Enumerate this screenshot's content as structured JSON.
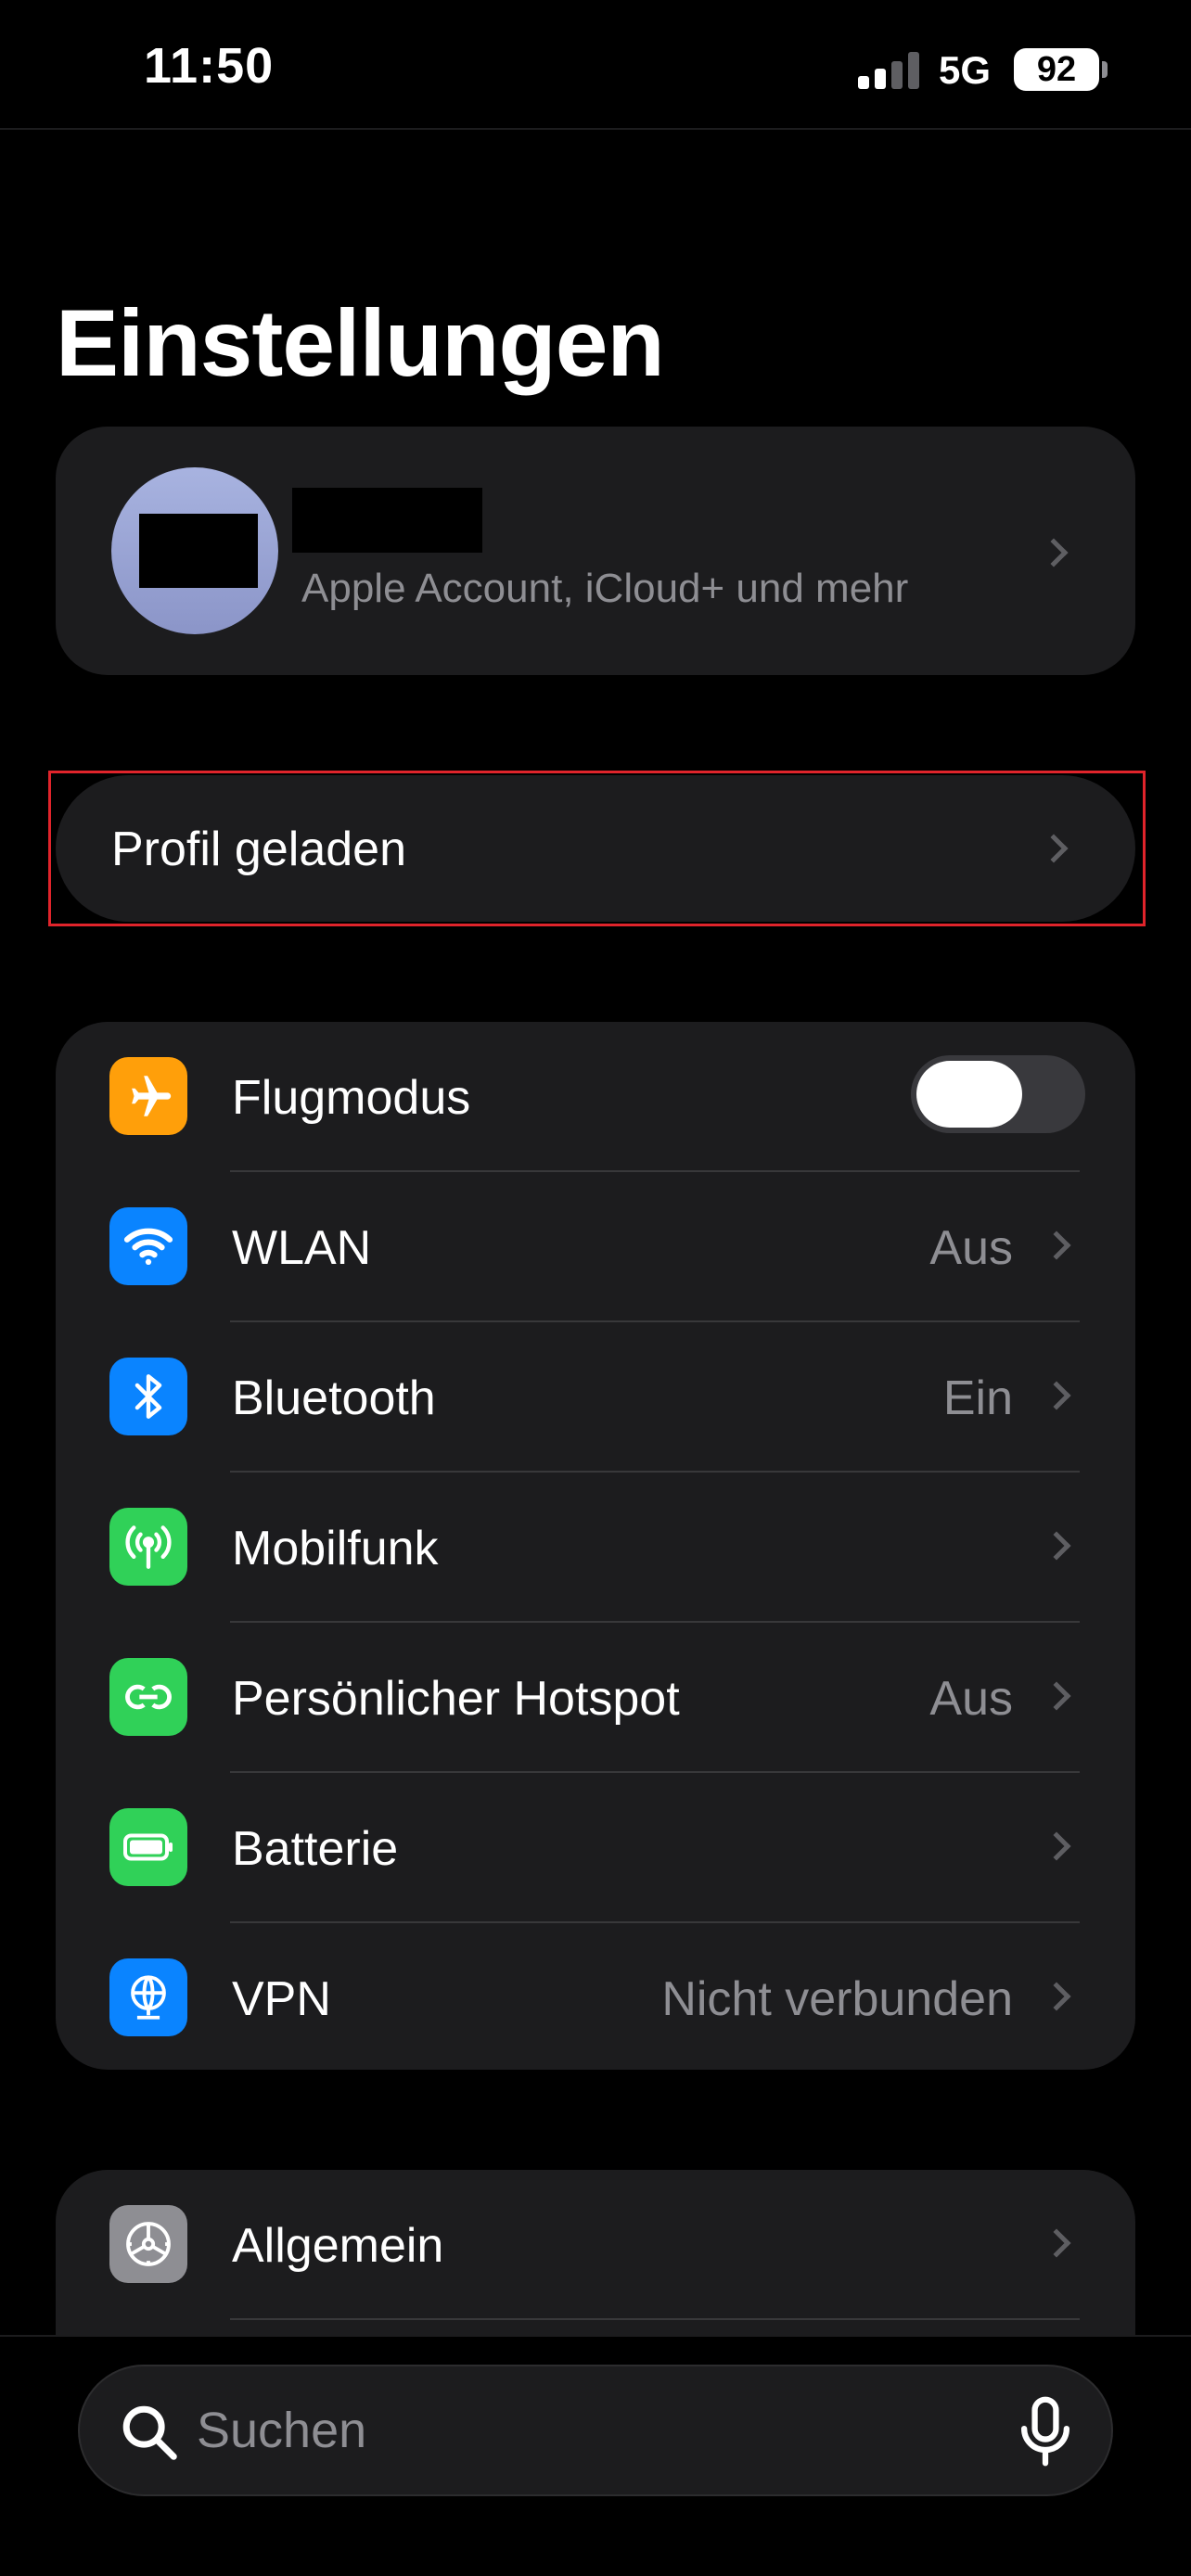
{
  "status_bar": {
    "time": "11:50",
    "network": "5G",
    "battery": "92"
  },
  "page": {
    "title": "Einstellungen"
  },
  "account": {
    "subtitle": "Apple Account, iCloud+ und mehr"
  },
  "profile": {
    "label": "Profil geladen"
  },
  "settings": [
    {
      "label": "Flugmodus",
      "icon": "airplane-icon",
      "color": "#ff9f0a",
      "toggle": false
    },
    {
      "label": "WLAN",
      "value": "Aus",
      "icon": "wifi-icon",
      "color": "#0a84ff"
    },
    {
      "label": "Bluetooth",
      "value": "Ein",
      "icon": "bluetooth-icon",
      "color": "#0a84ff"
    },
    {
      "label": "Mobilfunk",
      "value": "",
      "icon": "antenna-icon",
      "color": "#30d158"
    },
    {
      "label": "Persönlicher Hotspot",
      "value": "Aus",
      "icon": "hotspot-icon",
      "color": "#30d158"
    },
    {
      "label": "Batterie",
      "value": "",
      "icon": "battery-icon",
      "color": "#30d158"
    },
    {
      "label": "VPN",
      "value": "Nicht verbunden",
      "icon": "vpn-icon",
      "color": "#0a84ff"
    }
  ],
  "general": {
    "label": "Allgemein",
    "icon": "gear-icon",
    "color": "#8e8e93"
  },
  "search": {
    "placeholder": "Suchen"
  }
}
